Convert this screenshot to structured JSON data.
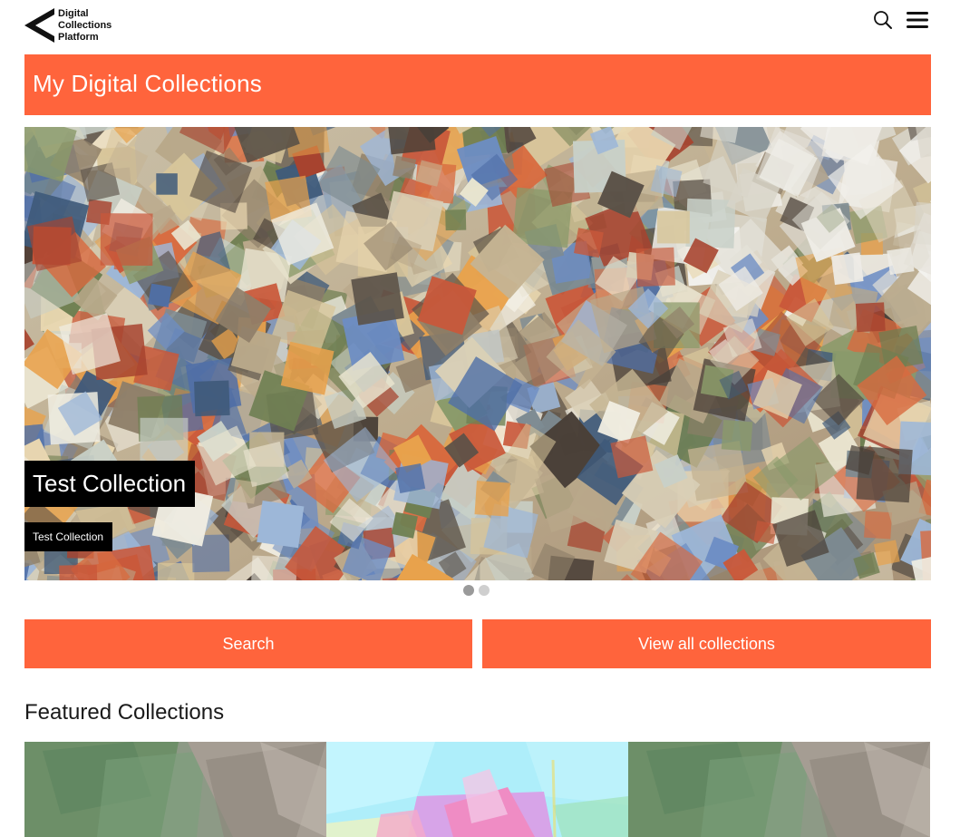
{
  "header": {
    "logo_lines": [
      "Digital",
      "Collections",
      "Platform"
    ],
    "icons": [
      "logo-arrow-icon",
      "search-icon",
      "hamburger-menu-icon"
    ]
  },
  "title_bar": {
    "title": "My Digital Collections"
  },
  "carousel": {
    "slides": [
      {
        "title": "Test Collection",
        "subtitle": "Test Collection"
      }
    ],
    "slide_count": 2,
    "active_index": 0
  },
  "actions": {
    "search_label": "Search",
    "view_all_label": "View all collections"
  },
  "featured": {
    "heading": "Featured Collections",
    "tile_count": 3
  },
  "colors": {
    "accent": "#ff643c",
    "caption_bg": "#000000",
    "dot_active": "#9a9a9a",
    "dot_inactive": "#cfcfcf"
  }
}
